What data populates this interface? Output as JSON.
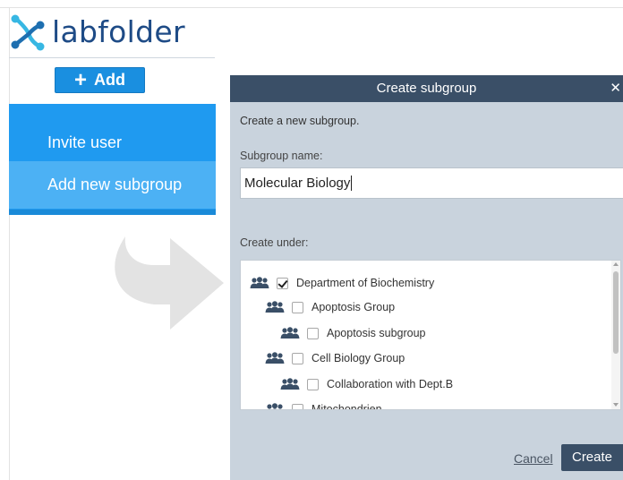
{
  "app": {
    "logo_text": "labfolder",
    "brand_color": "#1e4b86",
    "accent_color": "#1a8fe0"
  },
  "toolbar": {
    "add_label": "Add",
    "add_icon": "plus-icon"
  },
  "menu": {
    "items": [
      {
        "label": "Invite user",
        "active": false
      },
      {
        "label": "Add new subgroup",
        "active": true
      }
    ]
  },
  "modal": {
    "title": "Create subgroup",
    "close_icon": "close-icon",
    "intro": "Create a new subgroup.",
    "name_label": "Subgroup name:",
    "name_value": "Molecular Biology",
    "under_label": "Create under:",
    "tree": [
      {
        "label": "Department of Biochemistry",
        "level": 0,
        "checked": true,
        "icon": "group-icon"
      },
      {
        "label": "Apoptosis Group",
        "level": 1,
        "checked": false,
        "icon": "group-icon"
      },
      {
        "label": "Apoptosis subgroup",
        "level": 2,
        "checked": false,
        "icon": "group-icon"
      },
      {
        "label": "Cell Biology Group",
        "level": 1,
        "checked": false,
        "icon": "group-icon"
      },
      {
        "label": "Collaboration with Dept.B",
        "level": 2,
        "checked": false,
        "icon": "group-icon"
      },
      {
        "label": "Mitochondrien",
        "level": 1,
        "checked": false,
        "icon": "group-icon"
      }
    ],
    "cancel_label": "Cancel",
    "create_label": "Create"
  }
}
